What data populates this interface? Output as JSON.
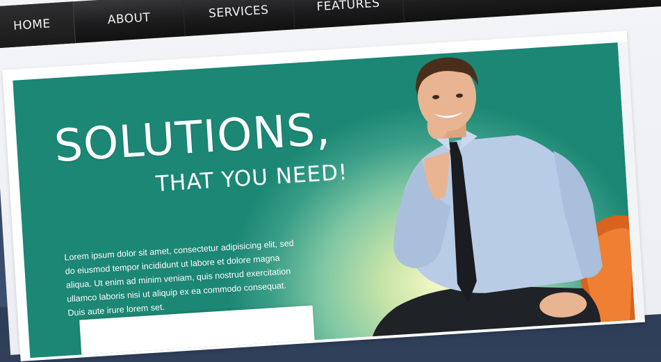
{
  "nav": {
    "items": [
      {
        "label": "HOME",
        "active": true
      },
      {
        "label": "ABOUT",
        "active": false
      },
      {
        "label": "SERVICES",
        "active": false
      },
      {
        "label": "FEATURES",
        "active": false
      },
      {
        "label": "",
        "active": false
      }
    ]
  },
  "hero": {
    "headline": "SOLUTIONS,",
    "subheadline": "THAT YOU NEED!",
    "body": "Lorem ipsum dolor sit amet, consectetur adipisicing elit, sed do eiusmod tempor incididunt ut labore et dolore magna aliqua. Ut enim ad minim veniam, quis nostrud exercitation ullamco laboris nisi ut aliquip ex ea commodo consequat. Duis aute irure lorem set."
  },
  "colors": {
    "nav_dark": "#1d1d1f",
    "hero_teal": "#1b8774",
    "hero_glow": "#f4f7c6",
    "chair_orange": "#d9621e",
    "shirt_blue": "#b8cce6"
  },
  "icons": {
    "person": "businessman-photo-icon",
    "chair": "chair-icon"
  }
}
